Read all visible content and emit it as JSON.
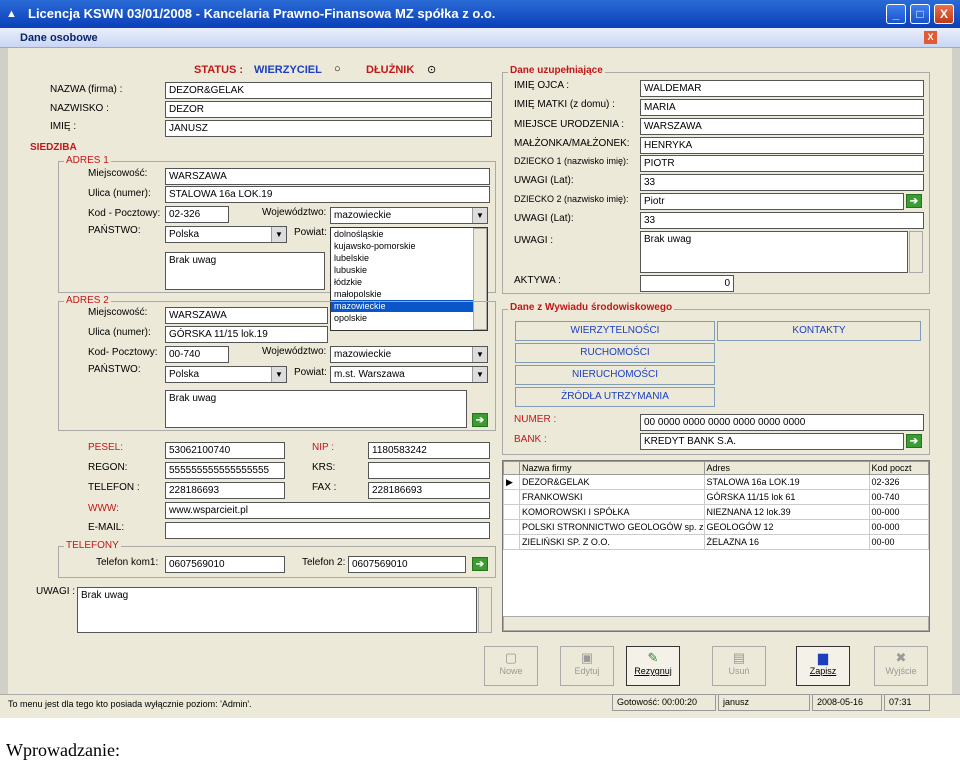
{
  "window": {
    "title": "Licencja KSWN 03/01/2008 - Kancelaria Prawno-Finansowa MZ spółka z o.o.",
    "subtitle": "Dane osobowe",
    "min": "_",
    "max": "□",
    "close": "X"
  },
  "status": {
    "label": "STATUS :",
    "creditor": "WIERZYCIEL",
    "debtor": "DŁUŻNIK",
    "creditor_radio": "○",
    "debtor_radio": "⊙"
  },
  "basic": {
    "name_lbl": "NAZWA (firma) :",
    "name": "DEZOR&GELAK",
    "surname_lbl": "NAZWISKO :",
    "surname": "DEZOR",
    "firstname_lbl": "IMIĘ :",
    "firstname": "JANUSZ"
  },
  "siedziba": "SIEDZIBA",
  "addr1": {
    "legend": "ADRES 1",
    "city_lbl": "Miejscowość:",
    "city": "WARSZAWA",
    "street_lbl": "Ulica (numer):",
    "street": "STALOWA 16a LOK.19",
    "zip_lbl": "Kod - Pocztowy:",
    "zip": "02-326",
    "voiv_lbl": "Województwo:",
    "voiv": "mazowieckie",
    "country_lbl": "PAŃSTWO:",
    "country": "Polska",
    "powiat_lbl": "Powiat:",
    "notes": "Brak uwag"
  },
  "voiv_list": [
    "dolnośląskie",
    "kujawsko-pomorskie",
    "lubelskie",
    "lubuskie",
    "łódzkie",
    "małopolskie",
    "mazowieckie",
    "opolskie"
  ],
  "addr2": {
    "legend": "ADRES 2",
    "city_lbl": "Miejscowość:",
    "city": "WARSZAWA",
    "street_lbl": "Ulica (numer):",
    "street": "GÓRSKA 11/15 lok.19",
    "zip_lbl": "Kod- Pocztowy:",
    "zip": "00-740",
    "voiv_lbl": "Województwo:",
    "voiv": "mazowieckie",
    "country_lbl": "PAŃSTWO:",
    "country": "Polska",
    "powiat_lbl": "Powiat:",
    "powiat": "m.st. Warszawa",
    "notes": "Brak uwag"
  },
  "ids": {
    "pesel_lbl": "PESEL:",
    "pesel": "53062100740",
    "nip_lbl": "NIP :",
    "nip": "1180583242",
    "regon_lbl": "REGON:",
    "regon": "555555555555555555",
    "krs_lbl": "KRS:",
    "krs": "",
    "tel_lbl": "TELEFON :",
    "tel": "228186693",
    "fax_lbl": "FAX :",
    "fax": "228186693",
    "www_lbl": "WWW:",
    "www": "www.wsparcieit.pl",
    "email_lbl": "E-MAIL:",
    "email": ""
  },
  "phones": {
    "legend": "TELEFONY",
    "kom1_lbl": "Telefon kom1:",
    "kom1": "0607569010",
    "tel2_lbl": "Telefon 2:",
    "tel2": "0607569010"
  },
  "uwagi": {
    "lbl": "UWAGI :",
    "val": "Brak uwag"
  },
  "extra": {
    "legend": "Dane uzupełniające",
    "father_lbl": "IMIĘ OJCA :",
    "father": "WALDEMAR",
    "mother_lbl": "IMIĘ MATKI (z domu) :",
    "mother": "MARIA",
    "birth_lbl": "MIEJSCE URODZENIA :",
    "birth": "WARSZAWA",
    "spouse_lbl": "MAŁŻONKA/MAŁŻONEK:",
    "spouse": "HENRYKA",
    "child1_lbl": "DZIECKO 1 (nazwisko imię):",
    "child1": "PIOTR",
    "notes1_lbl": "UWAGI (Lat):",
    "notes1": "33",
    "child2_lbl": "DZIECKO 2 (nazwisko imię):",
    "child2": "Piotr",
    "notes2_lbl": "UWAGI (Lat):",
    "notes2": "33",
    "uwagi_lbl": "UWAGI :",
    "uwagi": "Brak uwag",
    "aktywa_lbl": "AKTYWA :",
    "aktywa": "0"
  },
  "interview": {
    "legend": "Dane z Wywiadu środowiskowego",
    "btn1": "WIERZYTELNOŚCI",
    "btn2": "KONTAKTY",
    "btn3": "RUCHOMOŚCI",
    "btn4": "NIERUCHOMOŚCI",
    "btn5": "ŻRÓDŁA UTRZYMANIA",
    "numer_lbl": "NUMER :",
    "numer": "00 0000 0000 0000 0000 0000 0000",
    "bank_lbl": "BANK :",
    "bank": "KREDYT BANK S.A."
  },
  "grid": {
    "headers": [
      "Nazwa firmy",
      "Adres",
      "Kod poczt"
    ],
    "rows": [
      [
        "DEZOR&GELAK",
        "STALOWA 16a LOK.19",
        "02-326"
      ],
      [
        "FRANKOWSKI",
        "GÓRSKA 11/15 lok 61",
        "00-740"
      ],
      [
        "KOMOROWSKI I SPÓŁKA",
        "NIEZNANA 12 lok.39",
        "00-000"
      ],
      [
        "POLSKI STRONNICTWO GEOLOGÓW sp. z",
        "GEOLOGÓW 12",
        "00-000"
      ],
      [
        "ZIELIŃSKI SP. Z O.O.",
        "ŻELAZNA 16",
        "00-00"
      ]
    ]
  },
  "toolbar": {
    "new": "Nowe",
    "edit": "Edytuj",
    "cancel": "Rezygnuj",
    "delete": "Usuń",
    "save": "Zapisz",
    "exit": "Wyjście"
  },
  "statusbar": {
    "msg": "To menu jest dla tego kto posiada wyłącznie poziom: 'Admin'.",
    "ready": "Gotowość: 00:00:20",
    "user": "janusz",
    "date": "2008-05-16",
    "time": "07:31"
  },
  "caption": "Wprowadzanie:"
}
